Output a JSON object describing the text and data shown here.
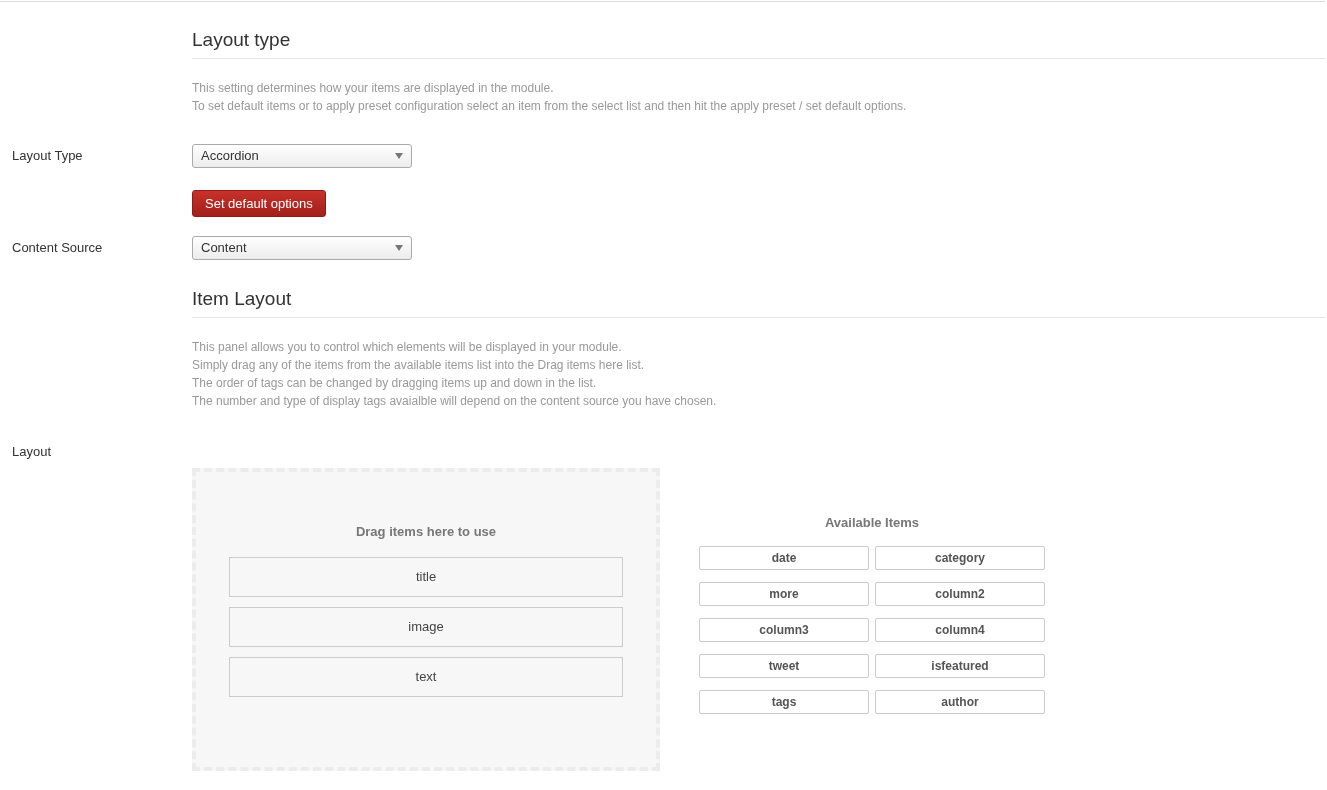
{
  "sections": [
    {
      "kind": "layout_type",
      "heading": "Layout type",
      "description": [
        "This setting determines how your items are displayed in the module.",
        "To set default items or to apply preset configuration select an item from the select list and then hit the apply preset / set default options."
      ],
      "fields": [
        {
          "label": "Layout Type",
          "value": "Accordion"
        }
      ],
      "button": "Set default options",
      "fields_after": [
        {
          "label": "Content Source",
          "value": "Content"
        }
      ]
    },
    {
      "kind": "item_layout",
      "heading": "Item Layout",
      "description": [
        "This panel allows you to control which elements will be displayed in your module.",
        "Simply drag any of the items from the available items list into the Drag items here list.",
        "The order of tags can be changed by dragging items up and down in the list.",
        "The number and type of display tags avaialble will depend on the content source you have chosen."
      ],
      "layout_label": "Layout",
      "drop_zone": {
        "title": "Drag items here to use",
        "items": [
          "title",
          "image",
          "text"
        ]
      },
      "available": {
        "title": "Available Items",
        "items": [
          "date",
          "category",
          "more",
          "column2",
          "column3",
          "column4",
          "tweet",
          "isfeatured",
          "tags",
          "author"
        ]
      }
    }
  ]
}
